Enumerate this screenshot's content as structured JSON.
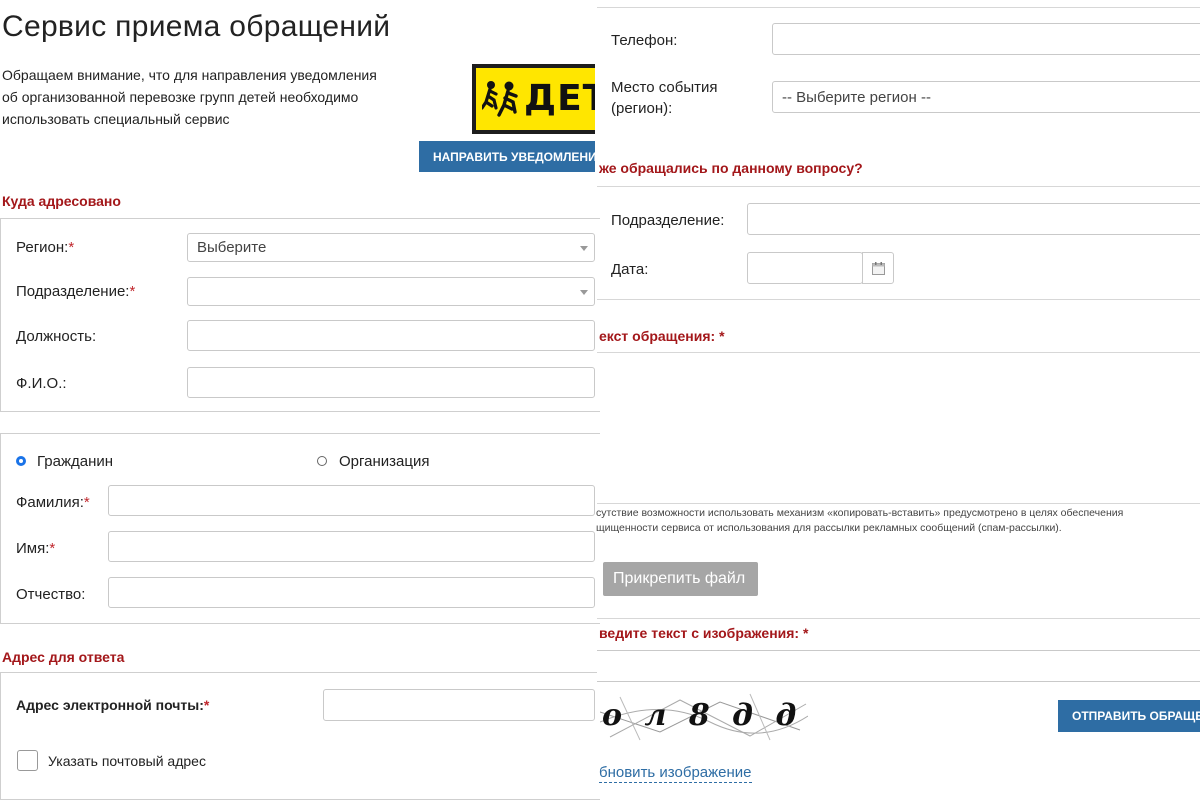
{
  "page_title": "Сервис приема обращений",
  "notice": {
    "line1": "Обращаем внимание, что для направления уведомления",
    "line2": "об организованной перевозке групп детей необходимо",
    "line3": "использовать специальный сервис",
    "banner_text": "ДЕТИ",
    "button_label": "НАПРАВИТЬ УВЕДОМЛЕНИЕ"
  },
  "addressee": {
    "heading": "Куда адресовано",
    "region_label": "Регион:",
    "region_value": "Выберите",
    "division_label": "Подразделение:",
    "division_value": "",
    "position_label": "Должность:",
    "fio_label": "Ф.И.О.:",
    "required_mark": "*"
  },
  "applicant": {
    "option_citizen": "Гражданин",
    "option_org": "Организация",
    "selected": "Гражданин",
    "lastname_label": "Фамилия:",
    "firstname_label": "Имя:",
    "patronymic_label": "Отчество:"
  },
  "reply_address": {
    "heading": "Адрес для ответа",
    "email_label": "Адрес электронной почты:",
    "postal_checkbox_label": "Указать почтовый адрес",
    "postal_checked": false
  },
  "contacts": {
    "phone_label": "Телефон:",
    "event_place_label_1": "Место события",
    "event_place_label_2": "(регион):",
    "region_select": "-- Выберите регион --"
  },
  "previous": {
    "heading": "же обращались по данному вопросу?",
    "division_label": "Подразделение:",
    "date_label": "Дата:"
  },
  "message": {
    "heading": "екст обращения:",
    "note_line1": "сутствие возможности использовать механизм «копировать-вставить» предусмотрено в целях обеспечения",
    "note_line2": "щищенности сервиса от использования для рассылки рекламных сообщений (спам-рассылки).",
    "attach_label": "Прикрепить файл"
  },
  "captcha": {
    "heading": "ведите текст с изображения:",
    "image_text": "о л 8 д д",
    "refresh_label": "бновить изображение",
    "submit_label": "ОТПРАВИТЬ ОБРАЩЕНИЕ"
  },
  "colors": {
    "heading_red": "#a3171a",
    "button_blue": "#2e6da4",
    "banner_yellow": "#ffe600",
    "radio_blue": "#1a73e8",
    "attach_gray": "#a6a6a6"
  }
}
